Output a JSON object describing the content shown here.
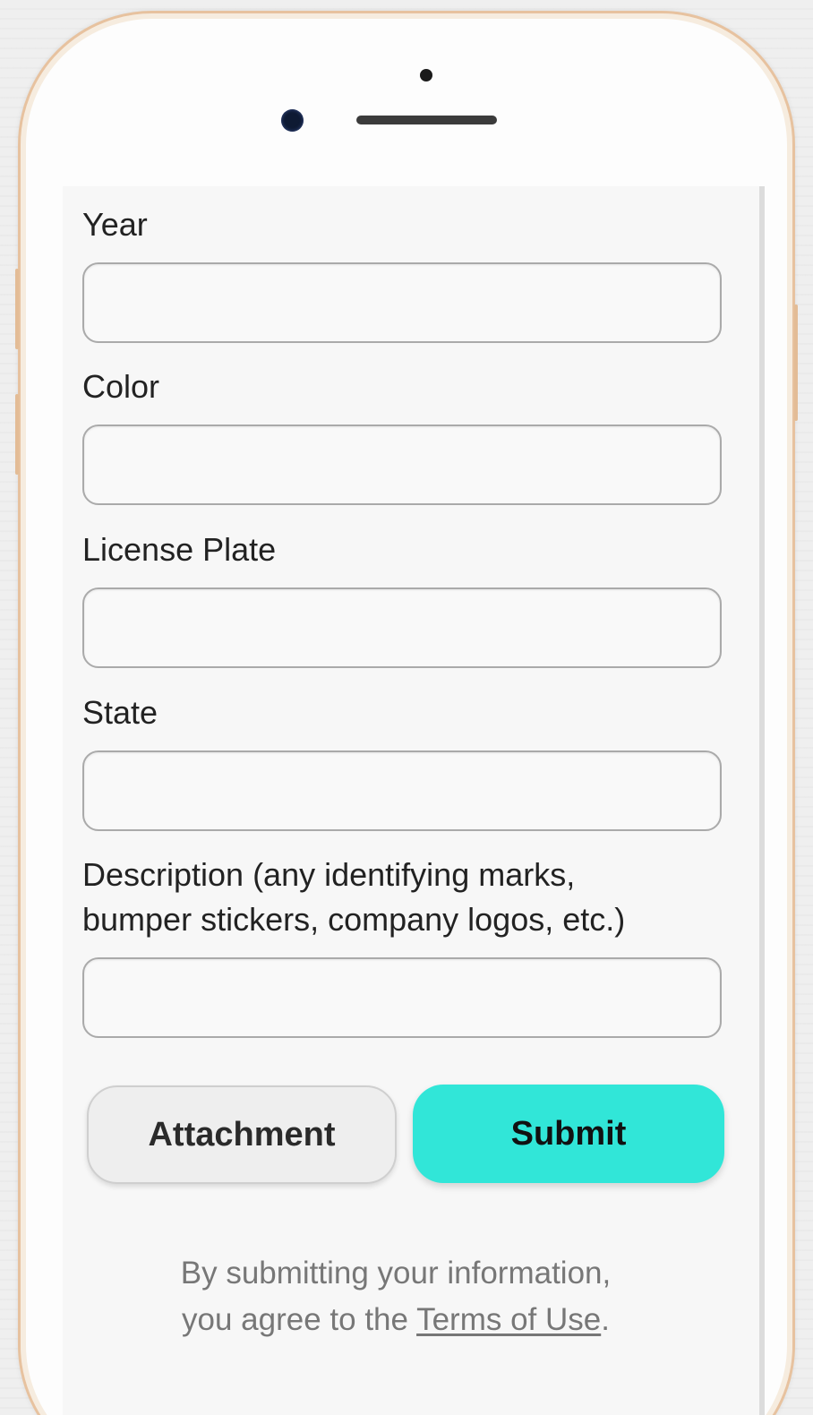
{
  "form": {
    "fields": [
      {
        "label": "Year",
        "value": "",
        "placeholder": ""
      },
      {
        "label": "Color",
        "value": "",
        "placeholder": ""
      },
      {
        "label": "License Plate",
        "value": "",
        "placeholder": ""
      },
      {
        "label": "State",
        "value": "",
        "placeholder": ""
      },
      {
        "label": "Description (any identifying marks,\nbumper stickers, company logos, etc.)",
        "value": "",
        "placeholder": ""
      }
    ],
    "attachment_label": "Attachment",
    "submit_label": "Submit"
  },
  "footer": {
    "terms_prefix": "By submitting your information,\nyou agree to the ",
    "terms_link": "Terms of Use",
    "terms_suffix": "."
  },
  "colors": {
    "accent": "#31e6d8",
    "phone_frame": "#e7c29f"
  }
}
